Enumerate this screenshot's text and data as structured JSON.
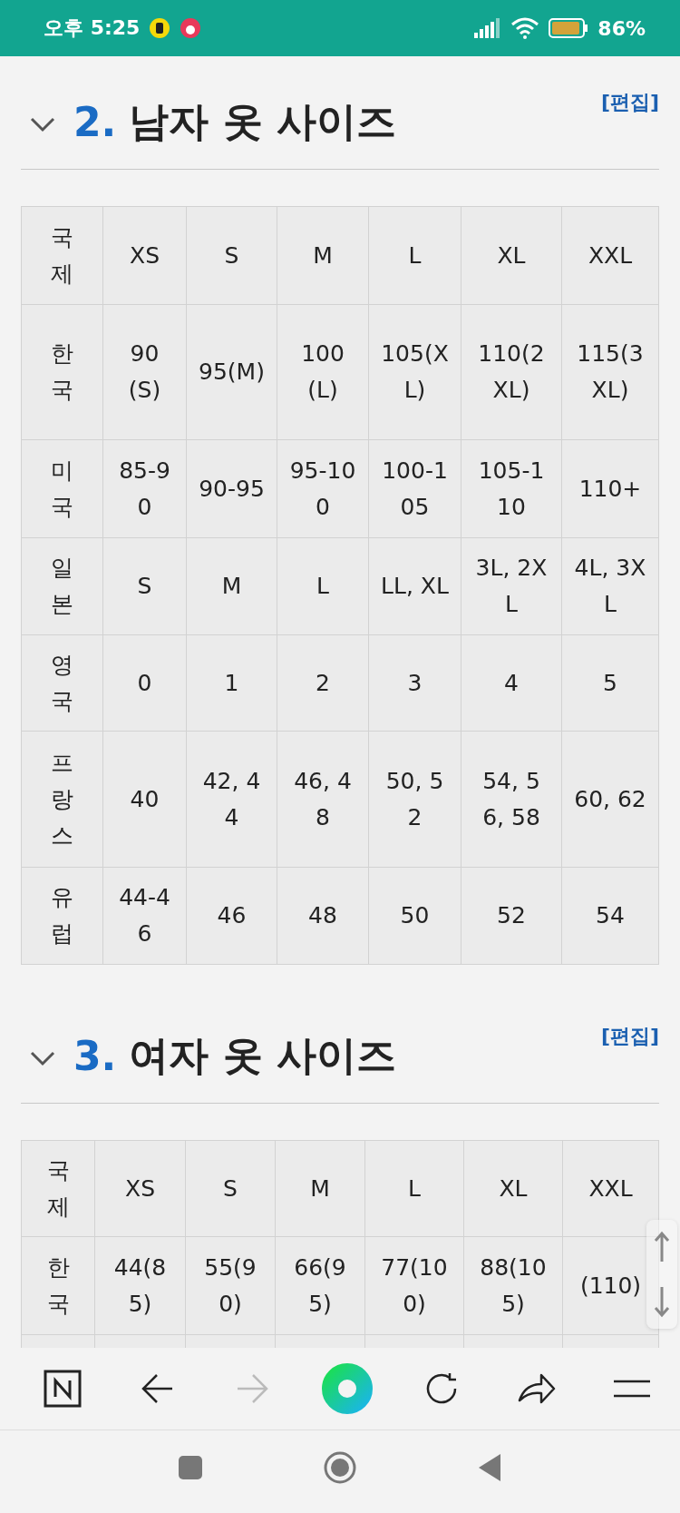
{
  "status_bar": {
    "time": "오후 5:25",
    "battery": "86%"
  },
  "sections": [
    {
      "number": "2.",
      "title": "남자 옷 사이즈",
      "edit_link": "[편집]",
      "table": {
        "rows": [
          [
            "국제",
            "XS",
            "S",
            "M",
            "L",
            "XL",
            "XXL"
          ],
          [
            "한국",
            "90(S)",
            "95(M)",
            "100(L)",
            "105(XL)",
            "110(2XL)",
            "115(3XL)"
          ],
          [
            "미국",
            "85-90",
            "90-95",
            "95-100",
            "100-105",
            "105-110",
            "110+"
          ],
          [
            "일본",
            "S",
            "M",
            "L",
            "LL, XL",
            "3L, 2XL",
            "4L, 3XL"
          ],
          [
            "영국",
            "0",
            "1",
            "2",
            "3",
            "4",
            "5"
          ],
          [
            "프랑스",
            "40",
            "42, 44",
            "46, 48",
            "50, 52",
            "54, 56, 58",
            "60, 62"
          ],
          [
            "유럽",
            "44-46",
            "46",
            "48",
            "50",
            "52",
            "54"
          ]
        ]
      }
    },
    {
      "number": "3.",
      "title": "여자 옷 사이즈",
      "edit_link": "[편집]",
      "table": {
        "rows": [
          [
            "국제",
            "XS",
            "S",
            "M",
            "L",
            "XL",
            "XXL"
          ],
          [
            "한국",
            "44(85)",
            "55(90)",
            "66(95)",
            "77(100)",
            "88(105)",
            "(110)"
          ]
        ]
      }
    }
  ],
  "toolbar": {
    "buttons": [
      {
        "kind": "home",
        "disabled": false
      },
      {
        "kind": "back",
        "disabled": false
      },
      {
        "kind": "forward",
        "disabled": true
      },
      {
        "kind": "green",
        "disabled": false
      },
      {
        "kind": "reload",
        "disabled": false
      },
      {
        "kind": "share",
        "disabled": false
      },
      {
        "kind": "menu",
        "disabled": false
      }
    ]
  }
}
